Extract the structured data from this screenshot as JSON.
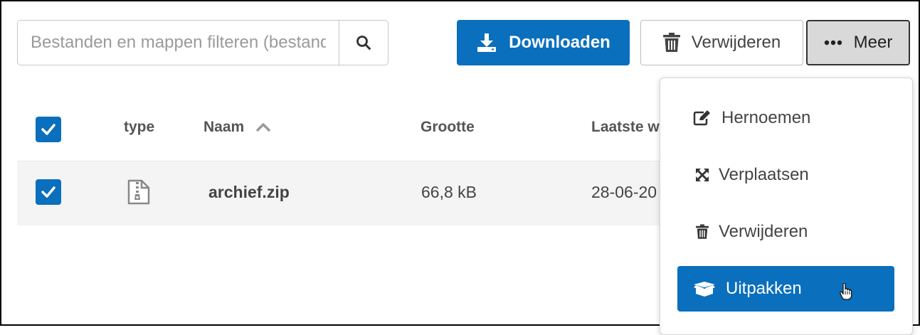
{
  "toolbar": {
    "search_placeholder": "Bestanden en mappen filteren (bestandsnaam)",
    "download_label": "Downloaden",
    "delete_label": "Verwijderen",
    "more_label": "Meer"
  },
  "table": {
    "headers": {
      "type": "type",
      "name": "Naam",
      "size": "Grootte",
      "modified": "Laatste w"
    },
    "rows": [
      {
        "name": "archief.zip",
        "size": "66,8 kB",
        "modified": "28-06-20",
        "selected": true,
        "icon": "zip-file-icon"
      }
    ]
  },
  "menu": {
    "items": [
      {
        "label": "Hernoemen",
        "icon": "edit-icon"
      },
      {
        "label": "Verplaatsen",
        "icon": "move-icon"
      },
      {
        "label": "Verwijderen",
        "icon": "trash-icon"
      },
      {
        "label": "Uitpakken",
        "icon": "box-open-icon",
        "active": true
      }
    ]
  },
  "colors": {
    "accent": "#0a6fbd",
    "row_bg": "#f4f4f4"
  }
}
